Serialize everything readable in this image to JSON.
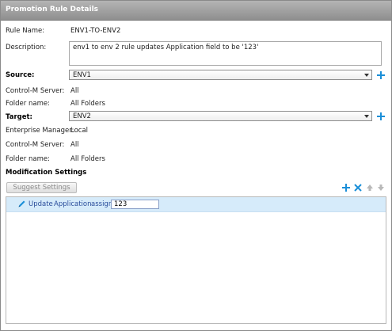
{
  "window": {
    "title": "Promotion Rule Details"
  },
  "rule": {
    "name_label": "Rule Name:",
    "name_value": "ENV1-TO-ENV2",
    "description_label": "Description:",
    "description_value": "env1 to env 2 rule updates Application field to be '123'"
  },
  "source": {
    "label": "Source:",
    "selected": "ENV1",
    "server_label": "Control-M Server:",
    "server_value": "All",
    "folder_label": "Folder name:",
    "folder_value": "All Folders"
  },
  "target": {
    "label": "Target:",
    "selected": "ENV2",
    "em_label": "Enterprise Manager:",
    "em_value": "Local",
    "server_label": "Control-M Server:",
    "server_value": "All",
    "folder_label": "Folder name:",
    "folder_value": "All Folders"
  },
  "modification": {
    "heading": "Modification Settings",
    "suggest_button": "Suggest Settings",
    "toolbar_icons": [
      "plus-icon",
      "delete-x-icon",
      "arrow-up-icon",
      "arrow-down-icon"
    ],
    "rows": [
      {
        "action": "Update",
        "field": "Application",
        "operation": "assign",
        "value": "123"
      }
    ]
  },
  "colors": {
    "accent": "#1b8fd8",
    "selected_row": "#d6ebfa",
    "title_bar": "#9f9f9f"
  }
}
